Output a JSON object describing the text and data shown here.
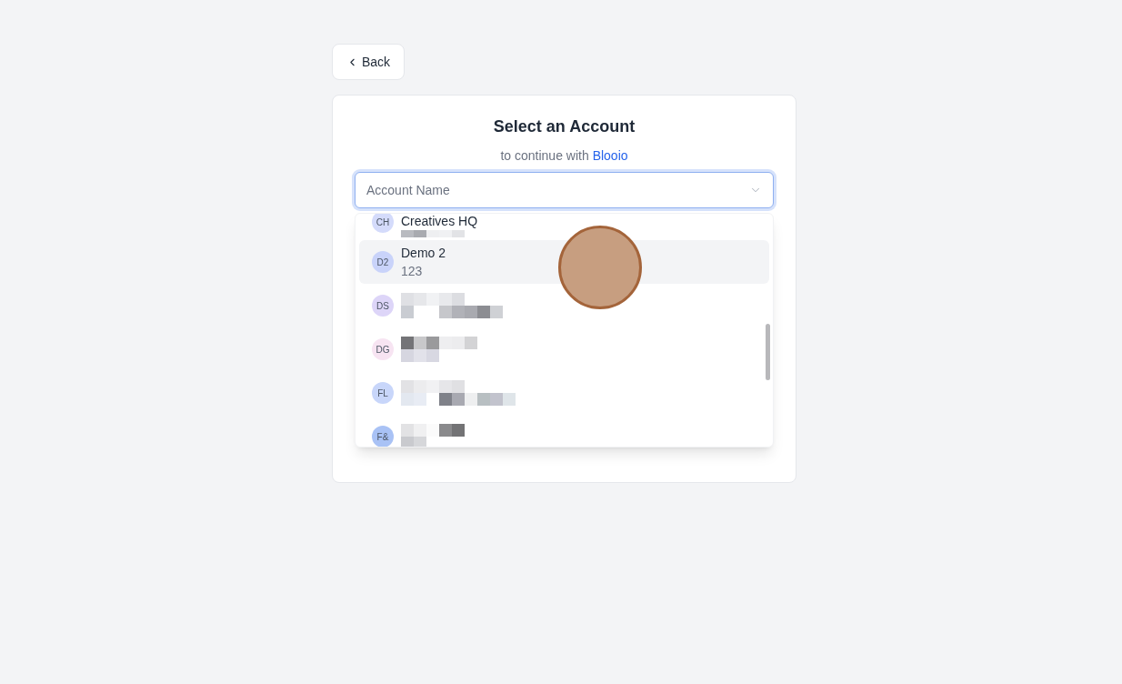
{
  "back_button": {
    "label": "Back"
  },
  "account_card": {
    "title": "Select an Account",
    "subtitle": "to continue with",
    "app_name": "Blooio",
    "account_select": {
      "placeholder": "Account Name",
      "expanded": true,
      "options": [
        {
          "initials": "CH",
          "color": "#d4dbfb",
          "name": "Creatives HQ",
          "selected": false
        },
        {
          "initials": "D2",
          "color": "#c9d3fa",
          "name": "Demo 2",
          "detail": "123",
          "selected": true
        },
        {
          "initials": "DS",
          "color": "#ddd5f8",
          "selected": false
        },
        {
          "initials": "DG",
          "color": "#f7e4f2",
          "selected": false
        },
        {
          "initials": "FL",
          "color": "#c8d6fa",
          "selected": false
        },
        {
          "initials": "F&",
          "color": "#a9c2f5",
          "selected": false
        }
      ]
    }
  }
}
